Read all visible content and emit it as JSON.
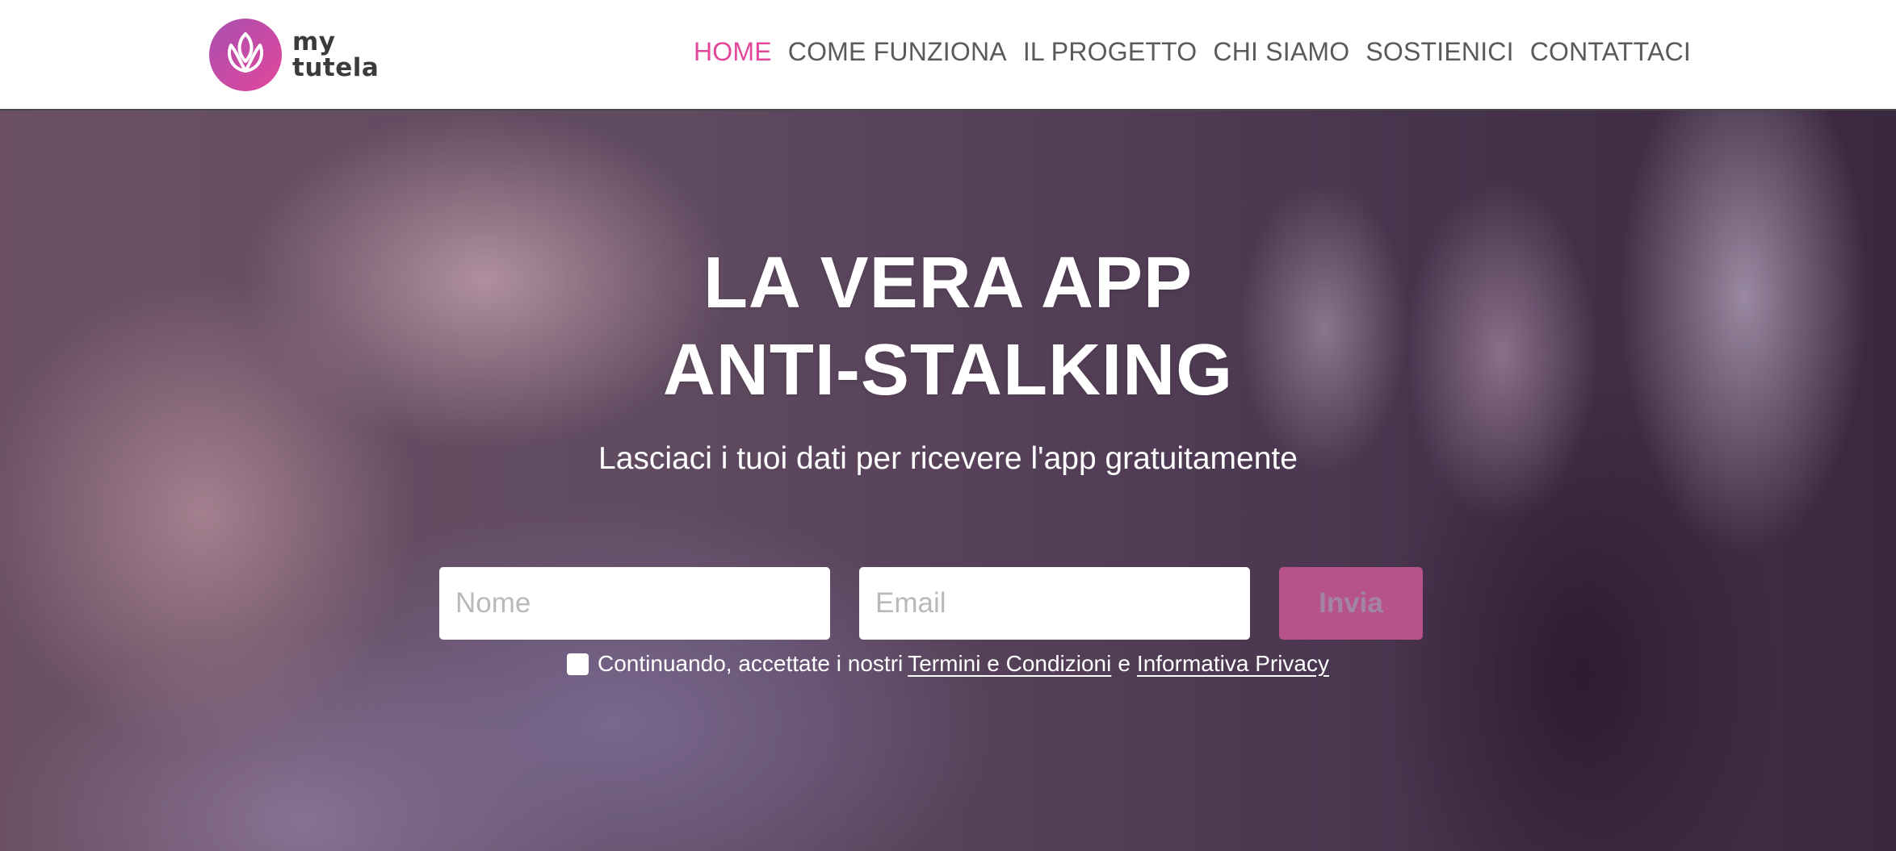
{
  "brand": {
    "logo_line1": "my",
    "logo_line2": "tutela",
    "accent_color": "#e3479a"
  },
  "nav": {
    "items": [
      {
        "label": "HOME",
        "active": true
      },
      {
        "label": "COME FUNZIONA",
        "active": false
      },
      {
        "label": "IL PROGETTO",
        "active": false
      },
      {
        "label": "CHI SIAMO",
        "active": false
      },
      {
        "label": "SOSTIENICI",
        "active": false
      },
      {
        "label": "CONTATTACI",
        "active": false
      }
    ]
  },
  "hero": {
    "title_line1": "LA VERA APP",
    "title_line2": "ANTI-STALKING",
    "subtitle": "Lasciaci i tuoi dati per ricevere l'app gratuitamente"
  },
  "form": {
    "name_placeholder": "Nome",
    "name_value": "",
    "email_placeholder": "Email",
    "email_value": "",
    "submit_label": "Invia",
    "consent": {
      "checked": false,
      "text_before": "Continuando, accettate i nostri",
      "terms_link": "Termini e Condizioni",
      "conjunction": "e",
      "privacy_link": "Informativa Privacy"
    }
  },
  "icons": {
    "logo": "lotus-logo-icon",
    "checkbox": "checkbox-icon"
  }
}
